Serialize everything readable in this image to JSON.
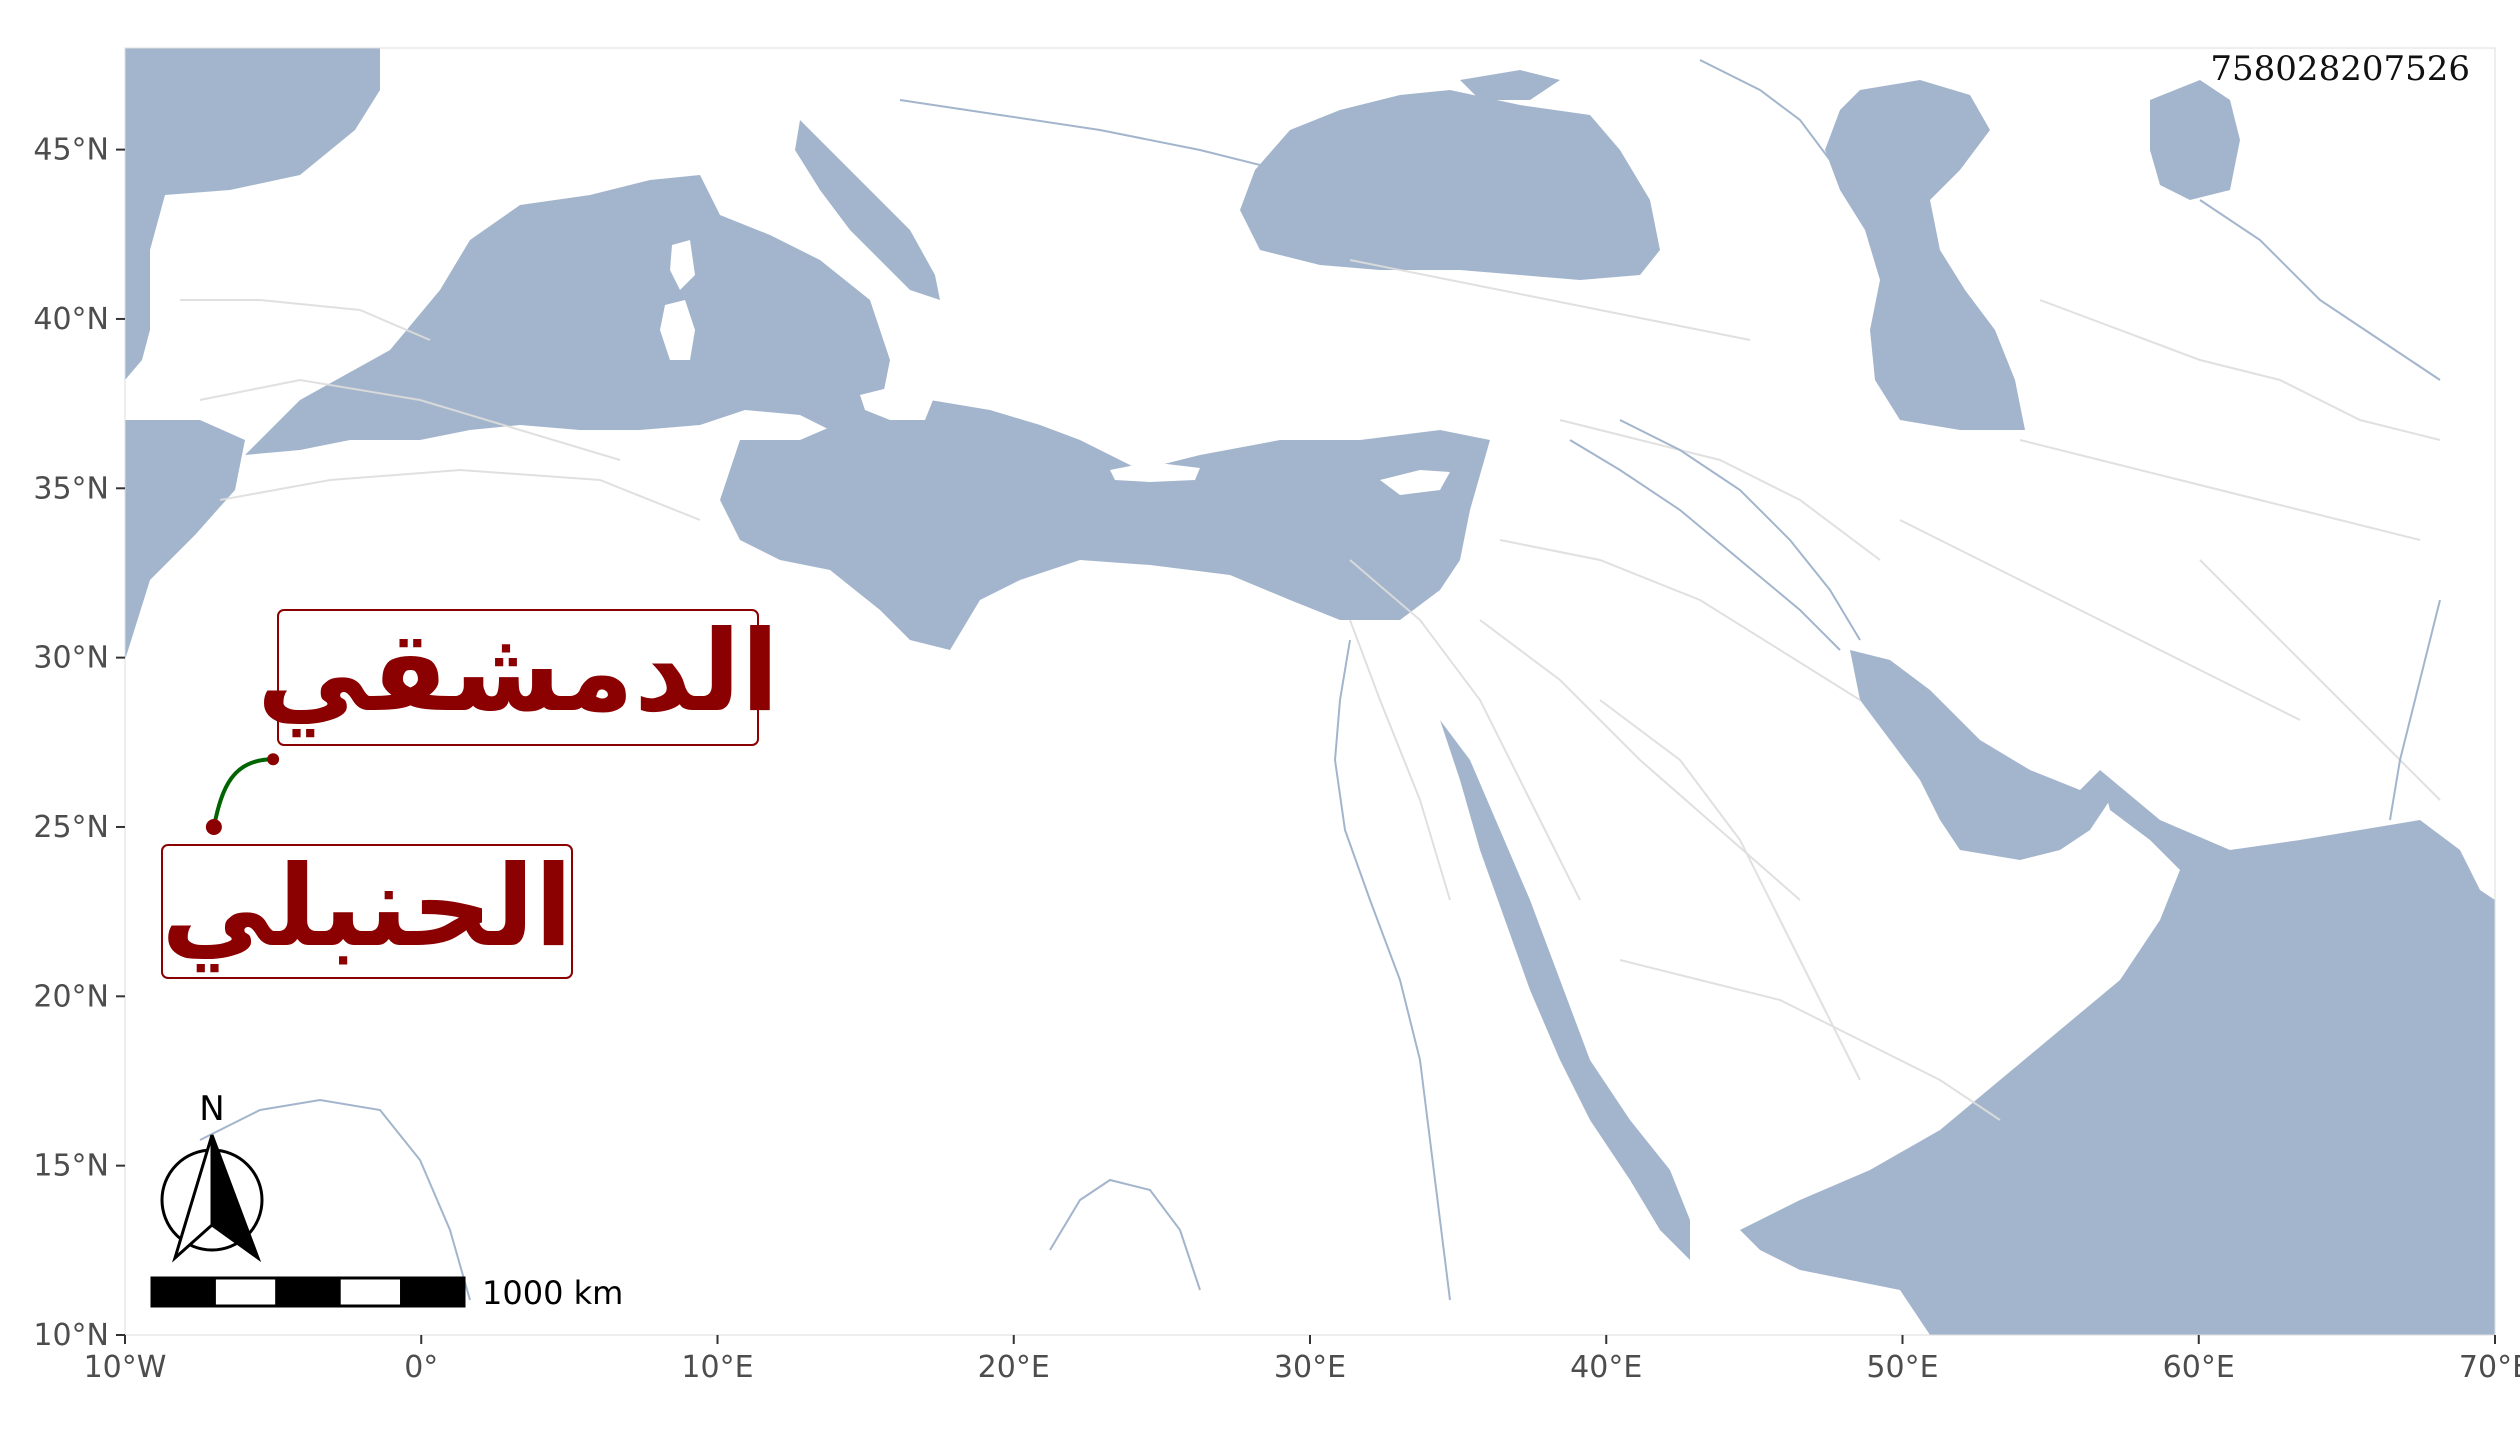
{
  "map": {
    "id_text": "758028207526",
    "extent": {
      "lon_min": -10,
      "lon_max": 70,
      "lat_min": 10,
      "lat_max": 48
    },
    "x_ticks": [
      {
        "lon": -10,
        "label": "10°W"
      },
      {
        "lon": 0,
        "label": "0°"
      },
      {
        "lon": 10,
        "label": "10°E"
      },
      {
        "lon": 20,
        "label": "20°E"
      },
      {
        "lon": 30,
        "label": "30°E"
      },
      {
        "lon": 40,
        "label": "40°E"
      },
      {
        "lon": 50,
        "label": "50°E"
      },
      {
        "lon": 60,
        "label": "60°E"
      },
      {
        "lon": 70,
        "label": "70°E"
      }
    ],
    "y_ticks": [
      {
        "lat": 45,
        "label": "45°N"
      },
      {
        "lat": 40,
        "label": "40°N"
      },
      {
        "lat": 35,
        "label": "35°N"
      },
      {
        "lat": 30,
        "label": "30°N"
      },
      {
        "lat": 25,
        "label": "25°N"
      },
      {
        "lat": 20,
        "label": "20°N"
      },
      {
        "lat": 15,
        "label": "15°N"
      },
      {
        "lat": 10,
        "label": "10°N"
      }
    ],
    "point": {
      "lon": -7.0,
      "lat": 25.0
    },
    "connector_end": {
      "lon": -5.0,
      "lat": 27.0
    },
    "labels": [
      {
        "text": "الدمشقي",
        "anchor": "connector_end"
      },
      {
        "text": "الحنبلي",
        "anchor": "point"
      }
    ],
    "scale_bar": {
      "label": "1000 km",
      "segments": 5
    },
    "north_arrow": {
      "letter": "N"
    },
    "colors": {
      "water": "#a3b5cc",
      "land": "#ffffff",
      "roads": "#dddddd",
      "label_text": "#8b0000",
      "label_border": "#8b0000",
      "connector": "#006400",
      "point": "#8b0000"
    }
  }
}
